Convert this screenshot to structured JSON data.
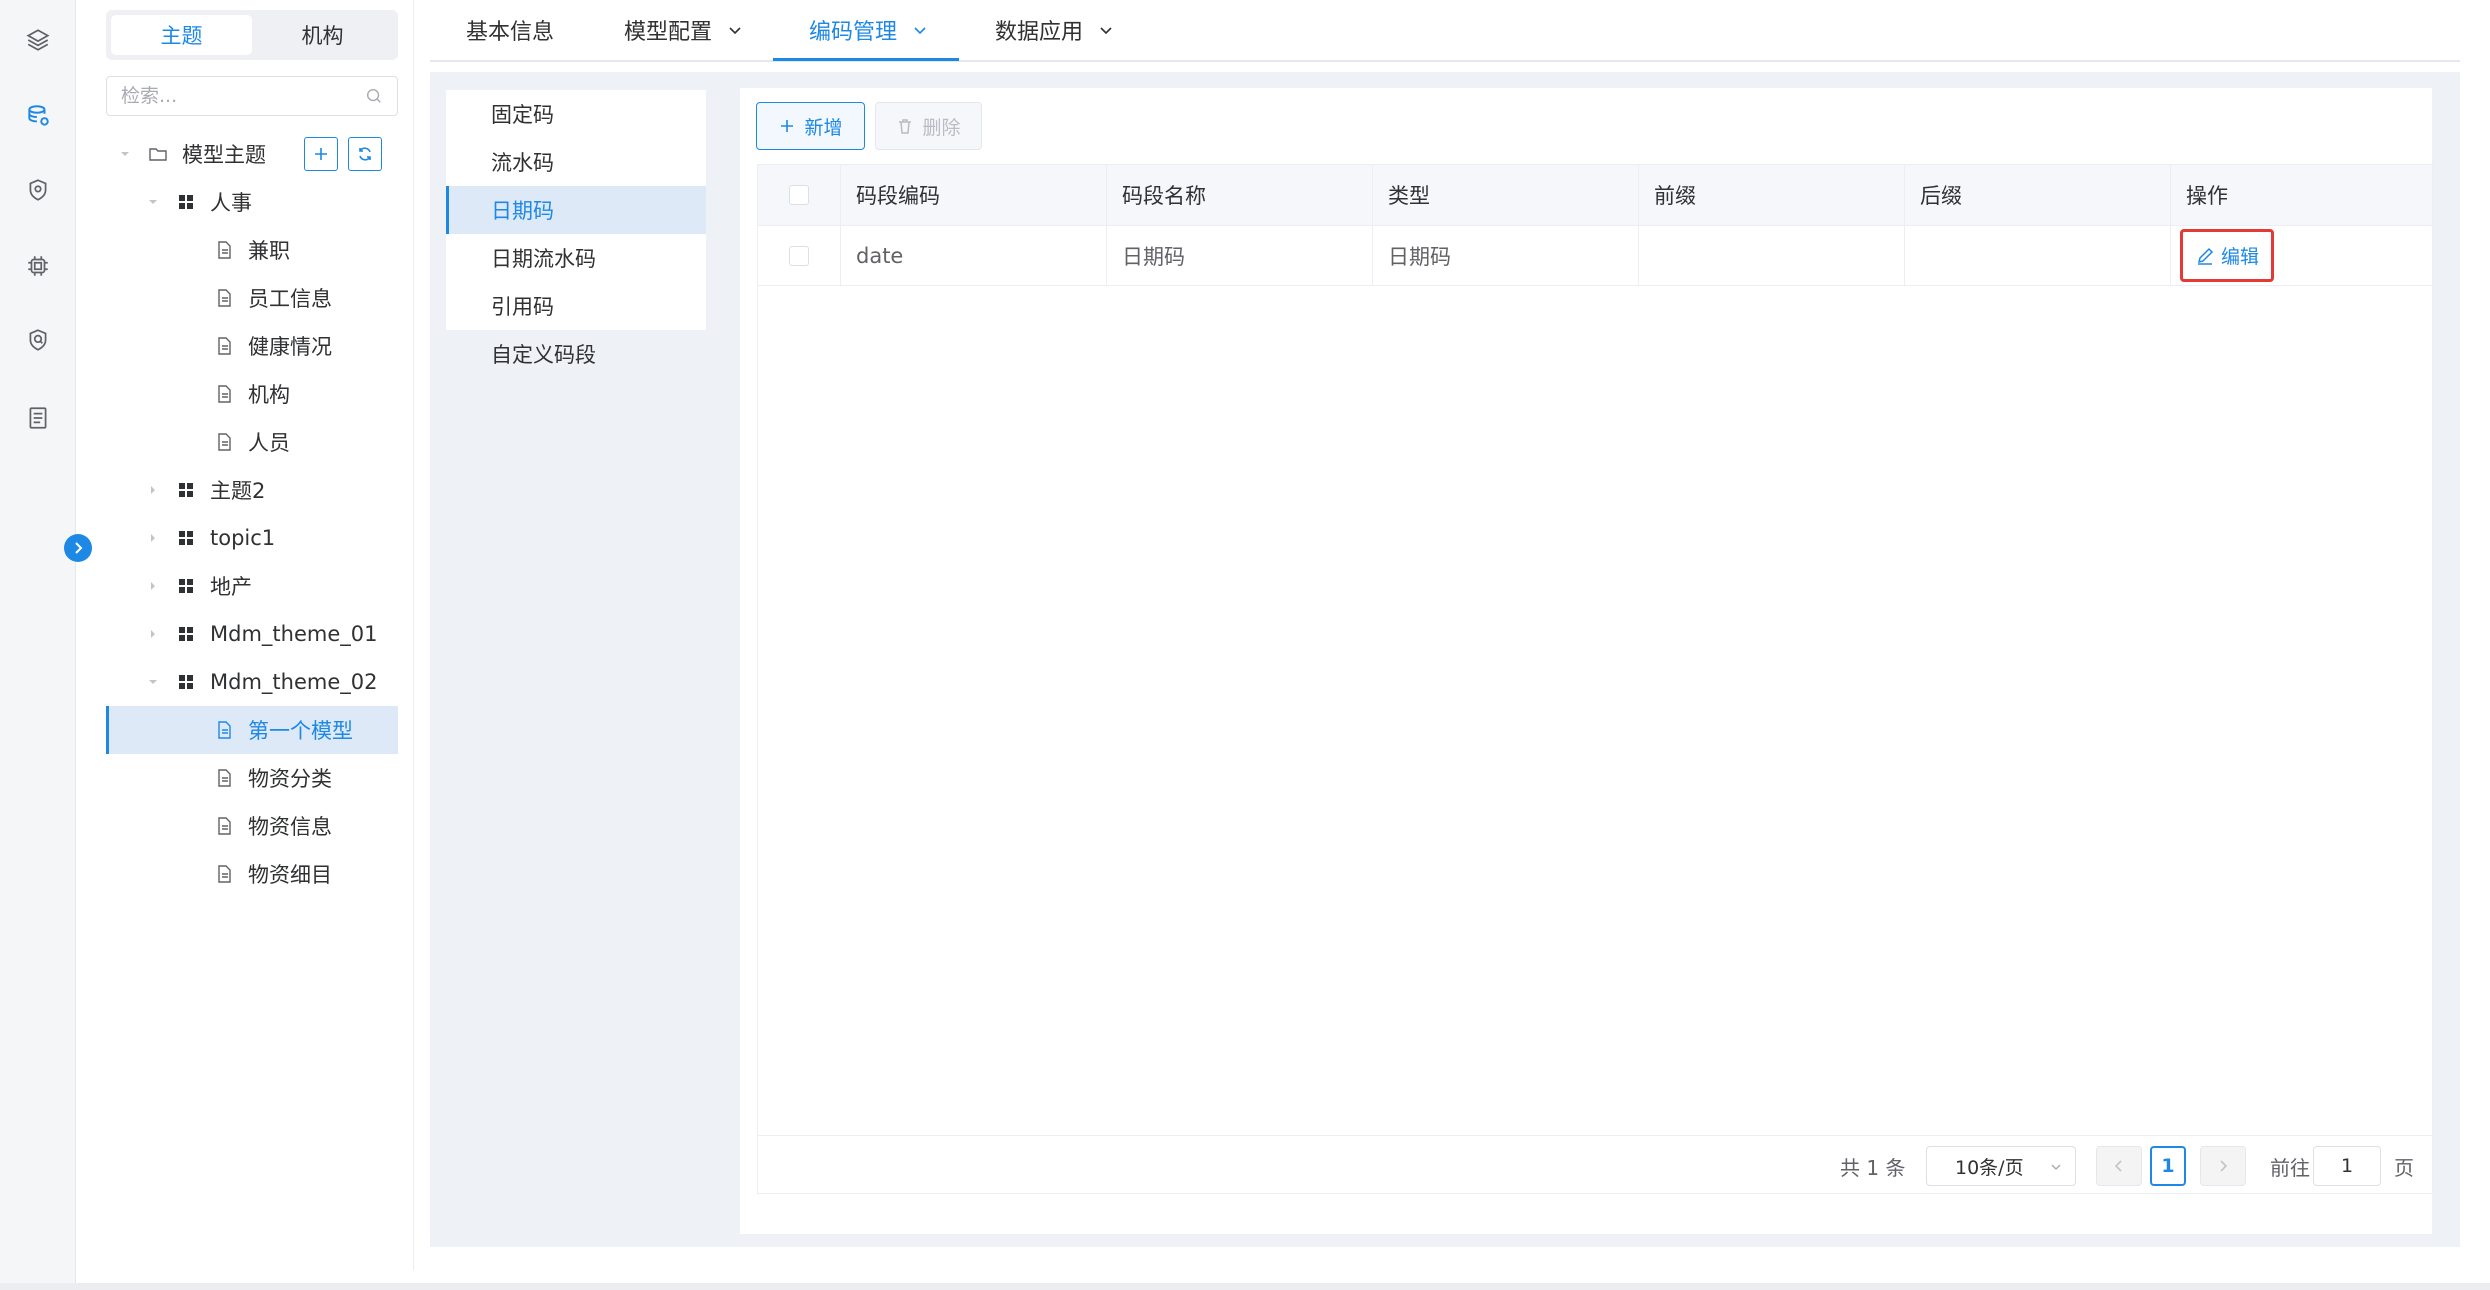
{
  "colors": {
    "accent": "#1e88e5",
    "highlight": "#e53935",
    "selected_bg": "#dde9f7"
  },
  "rail": {
    "icons": [
      "layers-icon",
      "database-icon",
      "location-shield-icon",
      "chip-icon",
      "security-shield-icon",
      "document-list-icon"
    ]
  },
  "tree_panel": {
    "seg_tabs": [
      "主题",
      "机构"
    ],
    "search_placeholder": "检索...",
    "root": "模型主题",
    "nodes": {
      "g1": "人事",
      "g1_items": [
        "兼职",
        "员工信息",
        "健康情况",
        "机构",
        "人员"
      ],
      "g2": "主题2",
      "g3": "topic1",
      "g4": "地产",
      "g5": "Mdm_theme_01",
      "g6": "Mdm_theme_02",
      "g6_items": [
        "第一个模型",
        "物资分类",
        "物资信息",
        "物资细目"
      ]
    }
  },
  "tabs": [
    "基本信息",
    "模型配置",
    "编码管理",
    "数据应用"
  ],
  "categories": [
    "固定码",
    "流水码",
    "日期码",
    "日期流水码",
    "引用码",
    "自定义码段"
  ],
  "toolbar": {
    "add": "新增",
    "delete": "删除"
  },
  "table": {
    "headers": [
      "码段编码",
      "码段名称",
      "类型",
      "前缀",
      "后缀",
      "操作"
    ],
    "rows": [
      {
        "code": "date",
        "name": "日期码",
        "type": "日期码",
        "prefix": "",
        "suffix": "",
        "action": "编辑"
      }
    ]
  },
  "pagination": {
    "total": "共 1 条",
    "page_size": "10条/页",
    "current": "1",
    "goto_label": "前往",
    "goto_value": "1",
    "page_suffix": "页"
  }
}
